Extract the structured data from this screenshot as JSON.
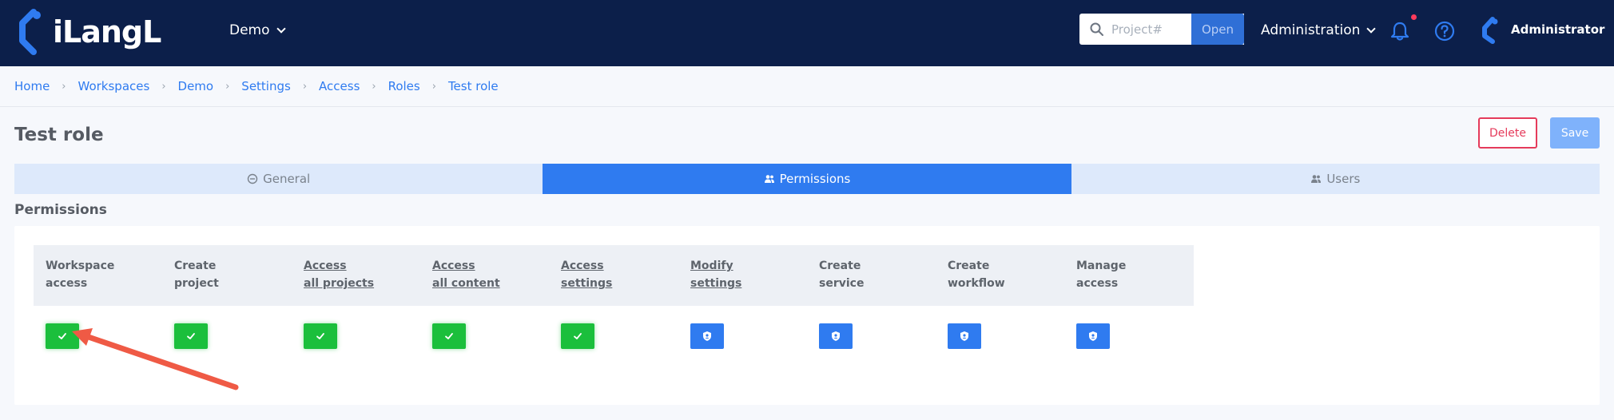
{
  "app": {
    "logo_text": "iLangL"
  },
  "header": {
    "workspace_label": "Demo",
    "search_placeholder": "Project#",
    "open_label": "Open",
    "admin_menu_label": "Administration",
    "user_name": "Administrator"
  },
  "breadcrumb": [
    "Home",
    "Workspaces",
    "Demo",
    "Settings",
    "Access",
    "Roles",
    "Test role"
  ],
  "page": {
    "title": "Test role",
    "delete_label": "Delete",
    "save_label": "Save"
  },
  "tabs": [
    {
      "label": "General",
      "icon": "minus-circle-icon",
      "active": false
    },
    {
      "label": "Permissions",
      "icon": "users-icon",
      "active": true
    },
    {
      "label": "Users",
      "icon": "users-icon",
      "active": false
    }
  ],
  "permissions": {
    "section_title": "Permissions",
    "columns": [
      {
        "line1": "Workspace",
        "line2": "access",
        "link": false,
        "state": "granted"
      },
      {
        "line1": "Create",
        "line2": "project",
        "link": false,
        "state": "granted"
      },
      {
        "line1": "Access",
        "line2": "all projects",
        "link": true,
        "state": "granted"
      },
      {
        "line1": "Access",
        "line2": "all content",
        "link": true,
        "state": "granted"
      },
      {
        "line1": "Access",
        "line2": "settings",
        "link": true,
        "state": "granted"
      },
      {
        "line1": "Modify",
        "line2": "settings",
        "link": true,
        "state": "restricted"
      },
      {
        "line1": "Create",
        "line2": "service",
        "link": false,
        "state": "restricted"
      },
      {
        "line1": "Create",
        "line2": "workflow",
        "link": false,
        "state": "restricted"
      },
      {
        "line1": "Manage",
        "line2": "access",
        "link": false,
        "state": "restricted"
      }
    ]
  },
  "colors": {
    "nav_bg": "#0c1f4a",
    "accent": "#2f7bf0",
    "granted": "#1bbf3c",
    "danger": "#e53b5b",
    "annotation_arrow": "#ef5a45"
  }
}
